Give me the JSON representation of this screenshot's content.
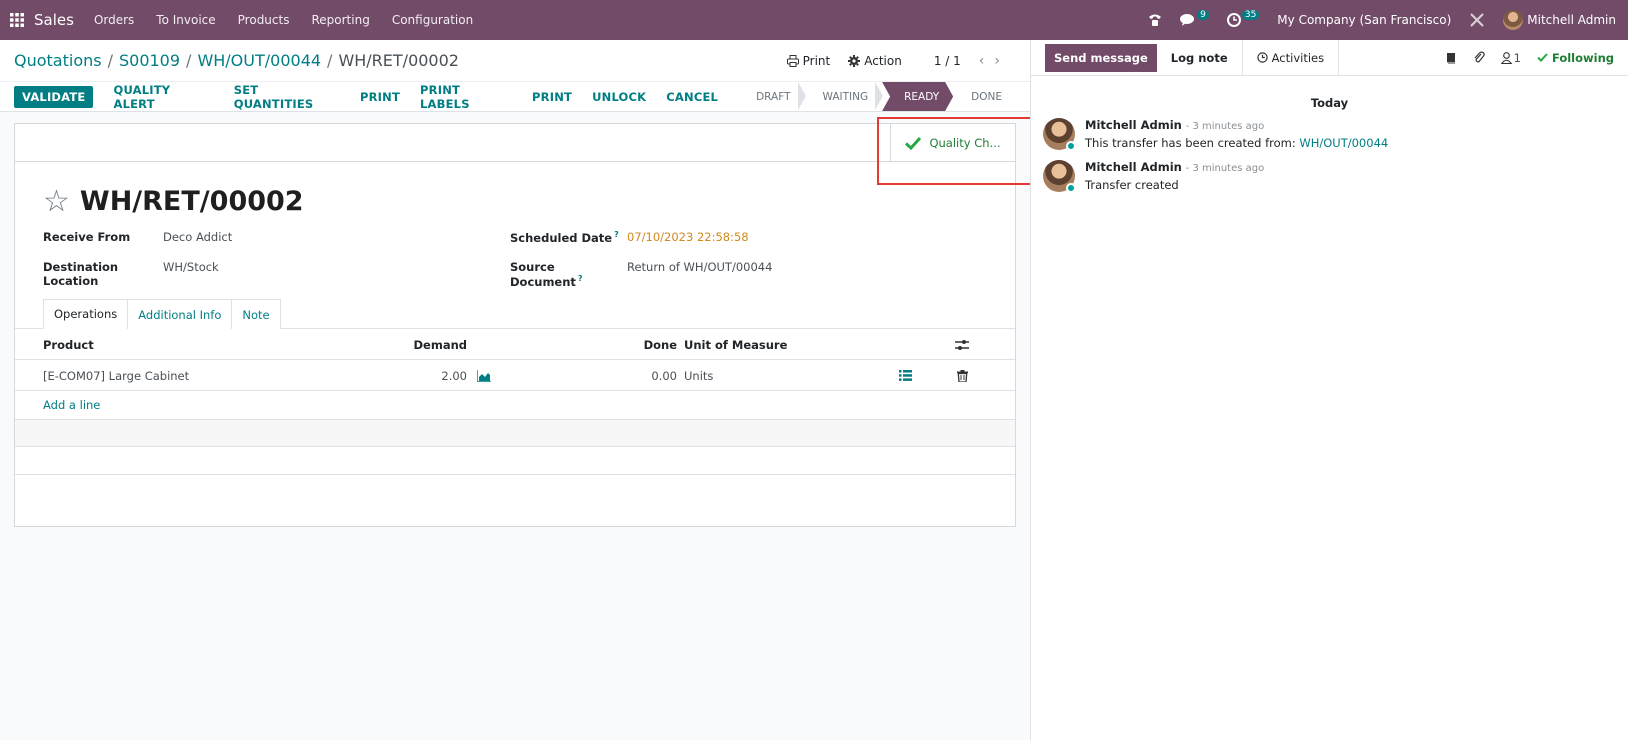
{
  "navbar": {
    "app_name": "Sales",
    "menu": [
      "Orders",
      "To Invoice",
      "Products",
      "Reporting",
      "Configuration"
    ],
    "messages_count": "9",
    "activities_count": "35",
    "company": "My Company (San Francisco)",
    "user": "Mitchell Admin"
  },
  "breadcrumb": {
    "items": [
      "Quotations",
      "S00109",
      "WH/OUT/00044"
    ],
    "current": "WH/RET/00002"
  },
  "control": {
    "print": "Print",
    "action": "Action",
    "pager": "1 / 1"
  },
  "actions": {
    "validate": "VALIDATE",
    "quality_alert": "QUALITY ALERT",
    "set_quantities": "SET QUANTITIES",
    "print": "PRINT",
    "print_labels": "PRINT LABELS",
    "print2": "PRINT",
    "unlock": "UNLOCK",
    "cancel": "CANCEL"
  },
  "status": {
    "stages": [
      "DRAFT",
      "WAITING",
      "READY",
      "DONE"
    ],
    "active": "READY"
  },
  "smart_button": {
    "label": "Quality Ch..."
  },
  "record": {
    "title": "WH/RET/00002",
    "receive_from_label": "Receive From",
    "receive_from": "Deco Addict",
    "destination_label": "Destination Location",
    "destination": "WH/Stock",
    "scheduled_label": "Scheduled Date",
    "scheduled": "07/10/2023 22:58:58",
    "source_label": "Source Document",
    "source": "Return of WH/OUT/00044",
    "help_mark": "?"
  },
  "tabs": [
    "Operations",
    "Additional Info",
    "Note"
  ],
  "table": {
    "headers": {
      "product": "Product",
      "demand": "Demand",
      "done": "Done",
      "uom": "Unit of Measure"
    },
    "rows": [
      {
        "product": "[E-COM07] Large Cabinet",
        "demand": "2.00",
        "done": "0.00",
        "uom": "Units"
      }
    ],
    "add_line": "Add a line"
  },
  "chatter": {
    "send_message": "Send message",
    "log_note": "Log note",
    "activities": "Activities",
    "followers": "1",
    "following": "Following",
    "today": "Today",
    "messages": [
      {
        "author": "Mitchell Admin",
        "when": "- 3 minutes ago",
        "text": "This transfer has been created from: ",
        "link": "WH/OUT/00044"
      },
      {
        "author": "Mitchell Admin",
        "when": "- 3 minutes ago",
        "text": "Transfer created",
        "link": ""
      }
    ]
  },
  "colors": {
    "brand": "#714b67",
    "accent": "#017e84",
    "success": "#1e7e34",
    "date": "#d08a1e",
    "highlight": "#e53935"
  }
}
